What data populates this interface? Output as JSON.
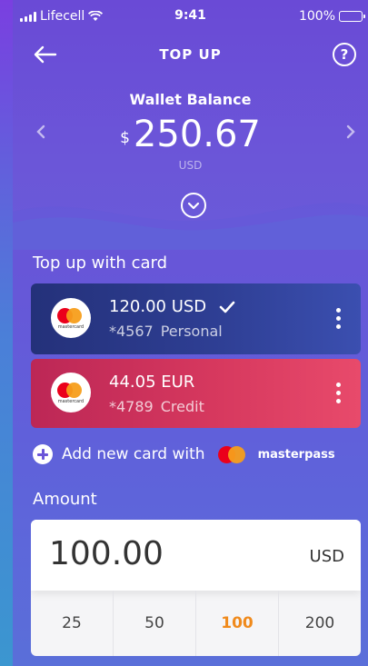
{
  "status_bar": {
    "carrier": "Lifecell",
    "time": "9:41",
    "battery": "100%"
  },
  "nav": {
    "title": "TOP UP",
    "help_label": "?"
  },
  "balance": {
    "label": "Wallet Balance",
    "currency_symbol": "$",
    "amount": "250.67",
    "unit": "USD"
  },
  "cards_section": {
    "title": "Top up with card",
    "cards": [
      {
        "amount": "120.00 USD",
        "number": "*4567",
        "name": "Personal",
        "selected": true,
        "brand": "mastercard"
      },
      {
        "amount": "44.05 EUR",
        "number": "*4789",
        "name": "Credit",
        "selected": false,
        "brand": "mastercard"
      }
    ],
    "add_card_label": "Add new card with",
    "masterpass_label": "masterpass"
  },
  "amount_section": {
    "title": "Amount",
    "value": "100.00",
    "currency": "USD",
    "presets": [
      "25",
      "50",
      "100",
      "200"
    ],
    "active_preset": "100"
  },
  "colors": {
    "accent_orange": "#f08a1c",
    "card_blue": "#2e3e93",
    "card_red": "#d6385e",
    "mastercard_red": "#eb001b",
    "mastercard_yellow": "#f79e1b"
  }
}
